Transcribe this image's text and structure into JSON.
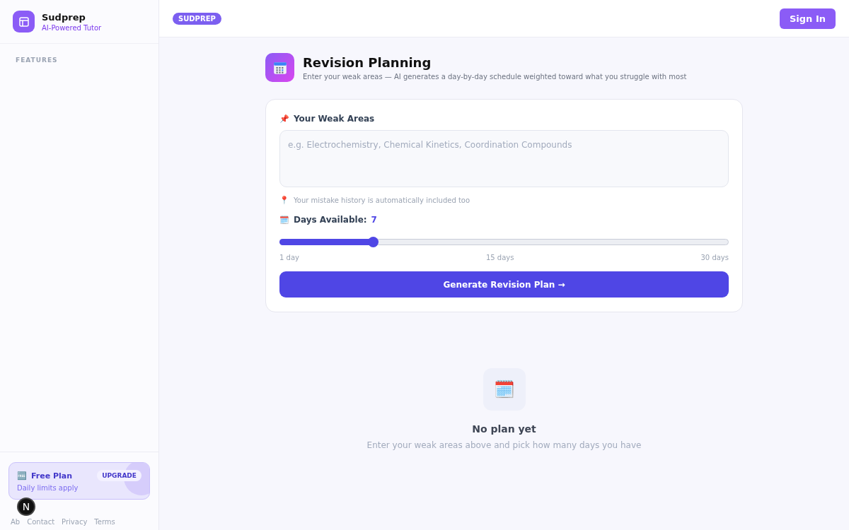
{
  "brand": {
    "name": "Sudprep",
    "tagline": "AI-Powered Tutor"
  },
  "sidebar": {
    "section": "FEATURES",
    "plan": {
      "icon": "🆓",
      "title": "Free Plan",
      "subtitle": "Daily limits apply",
      "action": "UPGRADE"
    },
    "footer_links": [
      "Ab",
      "Contact",
      "Privacy",
      "Terms"
    ],
    "avatar": "N"
  },
  "header": {
    "badge": "SUDPREP",
    "button": "Sign In"
  },
  "page": {
    "title": "Revision Planning",
    "subtitle": "Enter your weak areas — AI generates a day-by-day schedule weighted toward what you struggle with most"
  },
  "form": {
    "weak_label_icon": "📌",
    "weak_label": "Your Weak Areas",
    "weak_placeholder": "e.g. Electrochemistry, Chemical Kinetics, Coordination Compounds",
    "hint_icon": "📍",
    "hint": "Your mistake history is automatically included too",
    "days_icon": "🗓️",
    "days_label": "Days Available:",
    "days_value": "7",
    "slider": {
      "level": 0.207
    },
    "scale": [
      "1 day",
      "15 days",
      "30 days"
    ],
    "submit": "Generate Revision Plan →"
  },
  "empty": {
    "icon": "🗓️",
    "title": "No plan yet",
    "text": "Enter your weak areas above and pick how many days you have"
  }
}
